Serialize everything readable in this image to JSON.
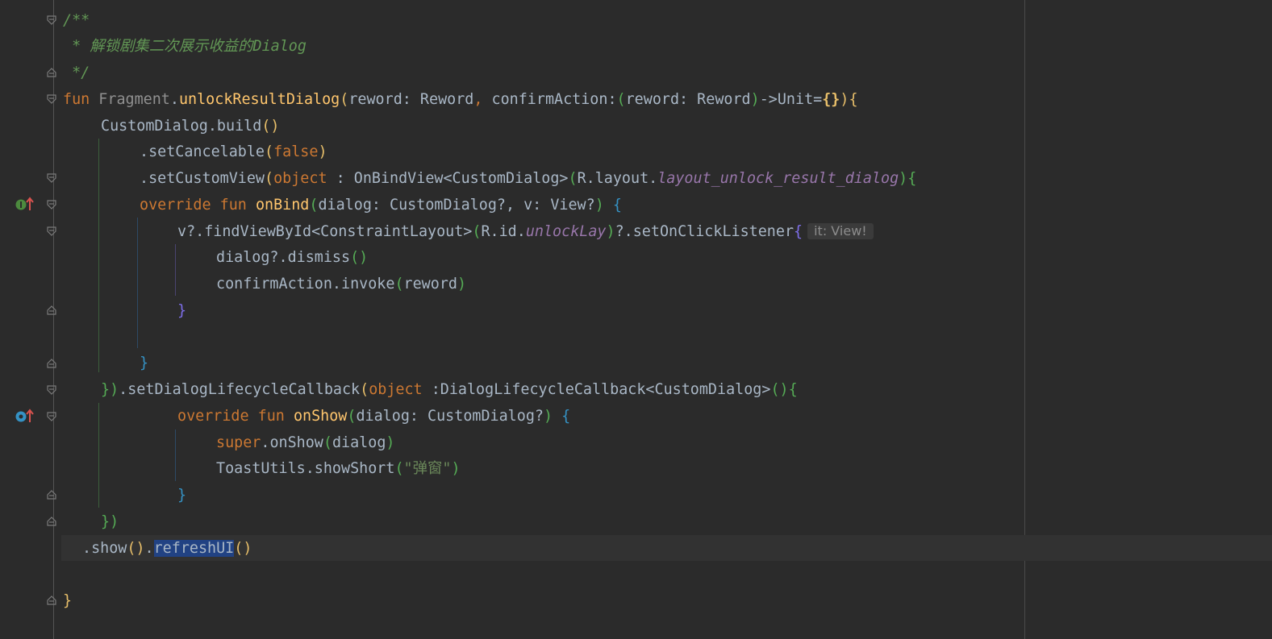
{
  "editor": {
    "language": "Kotlin",
    "theme": "Darcula",
    "colors": {
      "background": "#2b2b2b",
      "keyword": "#cc7832",
      "function": "#ffc66d",
      "comment": "#629755",
      "resource": "#9876aa",
      "string": "#6a8759",
      "selection": "#214283"
    },
    "code": {
      "l1": "/**",
      "l2": " * 解锁剧集二次展示收益的Dialog",
      "l3": " */",
      "l4": {
        "kw": "fun",
        "receiver": "Fragment",
        "name": "unlockResultDialog",
        "params_a": "reword: Reword",
        "params_b": " confirmAction:",
        "params_c": "reword: Reword",
        "ret": "->Unit="
      },
      "l5": "CustomDialog.build",
      "l6": {
        "call": ".setCancelable",
        "arg": "false"
      },
      "l7": {
        "call": ".setCustomView",
        "kw": "object",
        "type": " : OnBindView<CustomDialog>",
        "res_prefix": "R.layout.",
        "res": "layout_unlock_result_dialog"
      },
      "l8": {
        "kw": "override fun ",
        "name": "onBind",
        "params": "dialog: CustomDialog?, v: View?"
      },
      "l9": {
        "a": "v?.findViewById<ConstraintLayout>",
        "res_prefix": "R.id.",
        "res": "unlockLay",
        "b": "?.setOnClickListener",
        "hint": "it: View!"
      },
      "l10": "dialog?.dismiss",
      "l11": {
        "call": "confirmAction.invoke",
        "arg": "reword"
      },
      "l15": {
        "call": ".setDialogLifecycleCallback",
        "kw": "object",
        "type": " :DialogLifecycleCallback<CustomDialog>"
      },
      "l16": {
        "kw": "override fun ",
        "name": "onShow",
        "params": "dialog: CustomDialog?"
      },
      "l17": {
        "kw": "super",
        "call": ".onShow",
        "arg": "dialog"
      },
      "l18": {
        "call": "ToastUtils.showShort",
        "arg": "\"弹窗\""
      },
      "l21": {
        "a": ".show",
        "sel": "refreshUI"
      }
    },
    "gutter_icons": [
      "implements-icon",
      "overrides-icon"
    ]
  }
}
